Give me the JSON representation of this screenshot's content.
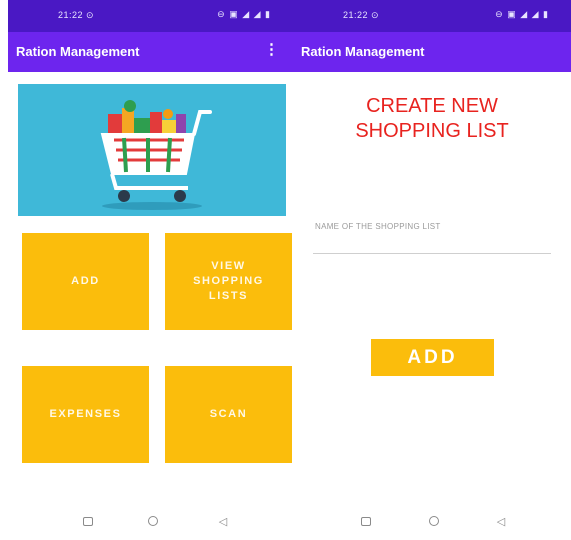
{
  "left_screen": {
    "status_bar": {
      "time": "21:22 ⊙",
      "icons": "⊖ ▣ ◢ ◢ ▮"
    },
    "app_bar": {
      "title": "Ration Management",
      "overflow_icon": "more-vert-icon",
      "overflow_glyph": "⋮"
    },
    "banner": {
      "image": "shopping-cart-illustration",
      "background": "#3fb8d8"
    },
    "tiles": [
      {
        "label": "ADD"
      },
      {
        "label": "VIEW\nSHOPPING\nLISTS"
      },
      {
        "label": "EXPENSES"
      },
      {
        "label": "SCAN"
      }
    ],
    "nav_bar": {
      "recents_icon": "square-icon",
      "home_icon": "circle-icon",
      "back_icon": "back-triangle-icon",
      "back_glyph": "◁"
    }
  },
  "right_screen": {
    "status_bar": {
      "time": "21:22 ⊙",
      "icons": "⊖ ▣ ◢ ◢ ▮"
    },
    "app_bar": {
      "title": "Ration Management"
    },
    "heading": {
      "line1": "CREATE NEW",
      "line2": "SHOPPING LIST"
    },
    "name_field": {
      "placeholder": "NAME OF THE SHOPPING LIST",
      "value": ""
    },
    "add_button": {
      "label": "ADD"
    },
    "nav_bar": {
      "recents_icon": "square-icon",
      "home_icon": "circle-icon",
      "back_icon": "back-triangle-icon",
      "back_glyph": "◁"
    }
  },
  "colors": {
    "status_bar": "#4a18c4",
    "app_bar": "#6d25ee",
    "tile": "#fbbd0c",
    "heading": "#e8231f"
  }
}
